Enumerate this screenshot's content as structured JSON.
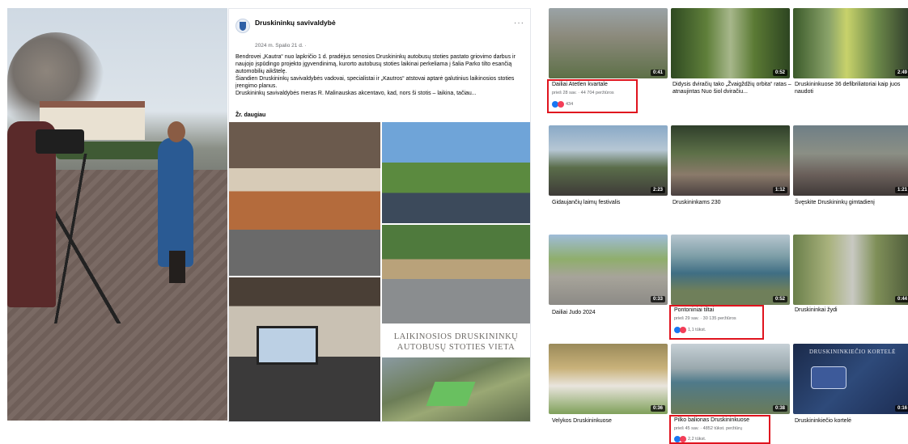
{
  "post": {
    "page_name": "Druskininkų savivaldybė",
    "date": "2024 m. Spalio 21 d. · ",
    "more": "···",
    "paragraphs": [
      "Bendrovei „Kautra“ nuo lapkričio 1 d. pradėjus senosios Druskininkų autobusų stoties pastato griovimo darbus ir naujojo įspūdingo projekto įgyvendinimą, kurorto autobusų stoties laikinai perkeliama į šalia Parko tilto esančią automobilių aikštelę.",
      "Šiandien Druskininkų savivaldybės vadovai, specialistai ir „Kautros“ atstovai aptarė galutinius laikinosios stoties įrengimo planus.",
      "Druskininkų savivaldybės meras R. Malinauskas akcentavo, kad, nors ši stotis – laikina, tačiau..."
    ],
    "see_more": "Žr. daugiau",
    "banner_text": "LAIKINOSIOS DRUSKININKŲ AUTOBUSŲ STOTIES VIETA"
  },
  "videos": [
    {
      "title": "Dailiai Atetlen kvartale",
      "duration": "0:41",
      "meta": "prieš 28 sav. · 44 704 peržiūros",
      "reactions": "434"
    },
    {
      "title": "Didysis dviračių tako „Žvaigždžių orbita“ ratas – atnaujintas Nuo šiol dviračiu...",
      "duration": "0:52"
    },
    {
      "title": "Druskininkuose 36 defibriliatoriai kaip juos naudoti",
      "duration": "2:49"
    },
    {
      "title": "Gidaujančių laimų festivalis",
      "duration": "2:23"
    },
    {
      "title": "Druskininkams 230",
      "duration": "1:12"
    },
    {
      "title": "Švęskite Druskininkų gimtadienį",
      "duration": "1:21"
    },
    {
      "title": "Dailiai Judo 2024",
      "duration": "0:33"
    },
    {
      "title": "Pontoniniai tiltai",
      "duration": "0:52",
      "meta": "prieš 29 sav. · 30 135 peržiūros",
      "reactions": "1,1 tūkst."
    },
    {
      "title": "Druskininkai žydi",
      "duration": "0:44"
    },
    {
      "title": "Velykos Druskininkuose",
      "duration": "0:36"
    },
    {
      "title": "Pilko balionas Druskininkuose",
      "duration": "0:38",
      "meta": "prieš 45 sav. · 4852 tūkst. peržiūrų",
      "reactions": "2,2 tūkst."
    },
    {
      "title": "Druskininkiečio kortelė",
      "duration": "0:16"
    }
  ],
  "card_thumb_text": "DRUSKININKIEČIO KORTELĖ"
}
